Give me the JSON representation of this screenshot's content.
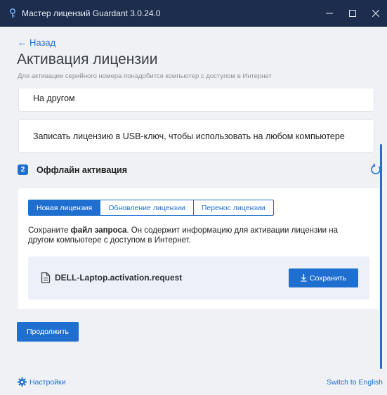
{
  "window": {
    "title": "Мастер лицензий Guardant 3.0.24.0",
    "app_icon": "guardant-key-icon",
    "controls": [
      "minimize-icon",
      "maximize-icon",
      "close-icon"
    ]
  },
  "nav": {
    "back_label": "Назад"
  },
  "page": {
    "title": "Активация лицензии",
    "subtitle": "Для активации серийного номера понадобится компьютер с доступом в Интернет"
  },
  "options": [
    {
      "label": "На другом"
    },
    {
      "label": "Записать лицензию в USB-ключ, чтобы использовать на любом компьютере"
    }
  ],
  "step": {
    "number": "2",
    "title": "Оффлайн активация",
    "refresh_icon": "refresh-icon"
  },
  "tabs": [
    {
      "label": "Новая лицензия",
      "active": true
    },
    {
      "label": "Обновление лицензии",
      "active": false
    },
    {
      "label": "Перенос лицензии",
      "active": false
    }
  ],
  "description": {
    "prefix": "Сохраните ",
    "bold": "файл запроса",
    "suffix": ". Он содержит информацию для активации лицензии на другом компьютере с доступом в Интернет."
  },
  "file": {
    "icon": "document-icon",
    "name": "DELL-Laptop.activation.request",
    "save_label": "Сохранить",
    "save_icon": "download-icon"
  },
  "actions": {
    "continue_label": "Продолжить"
  },
  "footer": {
    "settings_label": "Настройки",
    "settings_icon": "gear-icon",
    "language_label": "Switch to English"
  },
  "colors": {
    "accent": "#1f6fd1",
    "titlebar": "#1c2d4d",
    "background": "#f0f1f4",
    "file_box": "#eef0f9"
  }
}
